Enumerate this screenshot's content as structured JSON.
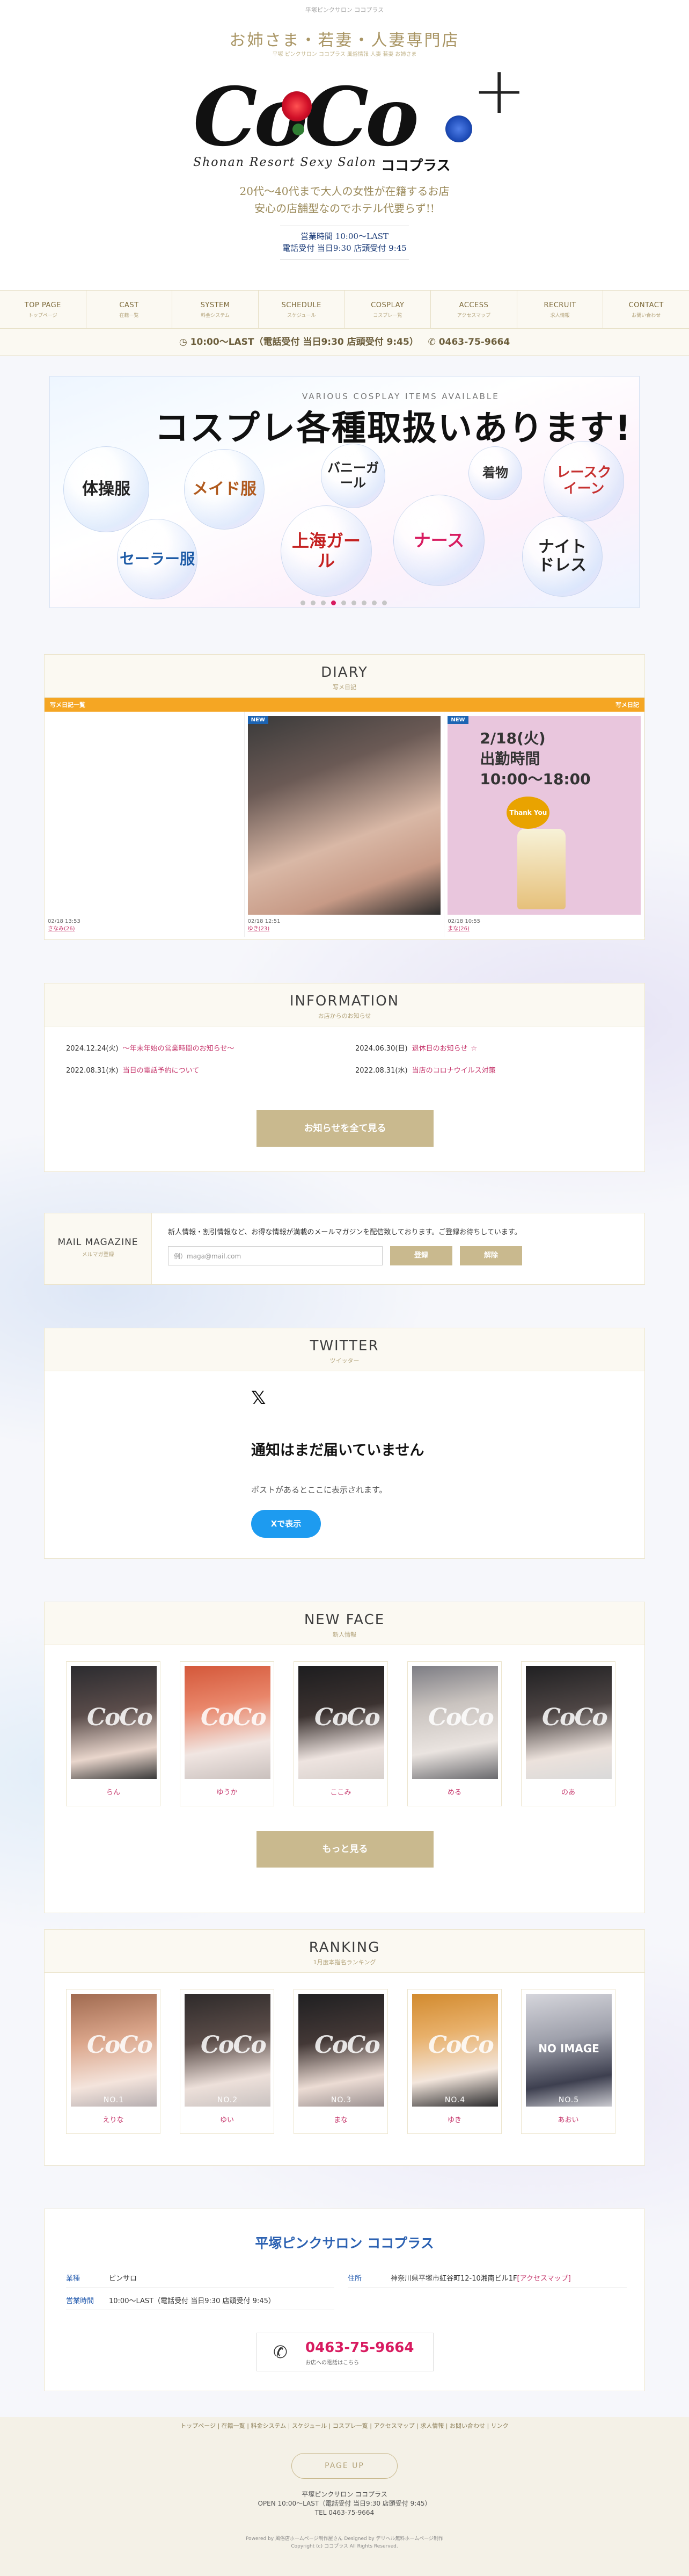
{
  "header": {
    "top_tagline": "平塚ピンクサロン ココプラス",
    "catch_main": "お姉さま・若妻・人妻専門店",
    "catch_sub": "平塚 ピンクサロン ココプラス 風俗情報 人妻 若妻 お姉さま",
    "logo_text": "CoCo",
    "logo_plus": "+",
    "logo_sub": "Shonan Resort Sexy Salon",
    "logo_kana": "ココプラス",
    "catch_line1": "20代～40代まで大人の女性が在籍するお店",
    "catch_line2": "安心の店舗型なのでホテル代要らず!!",
    "hours1": "営業時間 10:00～LAST",
    "hours2": "電話受付 当日9:30 店頭受付 9:45"
  },
  "nav": [
    {
      "en": "TOP PAGE",
      "jp": "トップページ"
    },
    {
      "en": "CAST",
      "jp": "在籍一覧"
    },
    {
      "en": "SYSTEM",
      "jp": "料金システム"
    },
    {
      "en": "SCHEDULE",
      "jp": "スケジュール"
    },
    {
      "en": "COSPLAY",
      "jp": "コスプレ一覧"
    },
    {
      "en": "ACCESS",
      "jp": "アクセスマップ"
    },
    {
      "en": "RECRUIT",
      "jp": "求人情報"
    },
    {
      "en": "CONTACT",
      "jp": "お問い合わせ"
    }
  ],
  "infobar": {
    "hours": "10:00～LAST（電話受付 当日9:30 店頭受付 9:45）",
    "tel": "0463-75-9664"
  },
  "banner": {
    "sub": "VARIOUS COSPLAY ITEMS AVAILABLE",
    "title": "コスプレ各種取扱いあります!",
    "items": [
      "体操服",
      "メイド服",
      "バニーガール",
      "着物",
      "レースクイーン",
      "セーラー服",
      "上海ガール",
      "ナース",
      "ナイトドレス"
    ],
    "slide_count": 9,
    "active_slide": 3
  },
  "diary": {
    "title": "DIARY",
    "sub": "写メ日記",
    "bar_left": "写メ日記一覧",
    "bar_right": "写メ日記",
    "new_tag": "NEW",
    "posts": [
      {
        "date": "02/18  13:53",
        "name": "さなみ(26)"
      },
      {
        "date": "02/18  12:51",
        "name": "ゆき(23)"
      },
      {
        "date": "02/18  10:55",
        "name": "まな(26)",
        "text1": "2/18(火)",
        "text2": "出勤時間",
        "text3": "10:00～18:00",
        "sticker": "Thank You"
      }
    ]
  },
  "information": {
    "title": "INFORMATION",
    "sub": "お店からのお知らせ",
    "items": [
      {
        "date": "2024.12.24(火)",
        "title": "年末年始の営業時間のお知らせ"
      },
      {
        "date": "2024.06.30(日)",
        "title": "退休日のお知らせ"
      },
      {
        "date": "2022.08.31(水)",
        "title": "当日の電話予約について"
      },
      {
        "date": "2022.08.31(水)",
        "title": "当店のコロナウイルス対策"
      }
    ],
    "button": "お知らせを全て見る"
  },
  "mail": {
    "title": "MAIL MAGAZINE",
    "sub": "メルマガ登録",
    "desc": "新人情報・割引情報など、お得な情報が満載のメールマガジンを配信致しております。ご登録お待ちしています。",
    "placeholder": "例）maga@mail.com",
    "register": "登録",
    "cancel": "解除"
  },
  "twitter": {
    "title": "TWITTER",
    "sub": "ツイッター",
    "icon": "x-logo-icon",
    "heading": "通知はまだ届いていません",
    "body": "ポストがあるとここに表示されます。",
    "button": "Xで表示"
  },
  "newface": {
    "title": "NEW FACE",
    "sub": "新人情報",
    "girls": [
      {
        "name": "らん"
      },
      {
        "name": "ゆうか"
      },
      {
        "name": "ここみ"
      },
      {
        "name": "める"
      },
      {
        "name": "のあ"
      }
    ],
    "button": "もっと見る"
  },
  "ranking": {
    "title": "RANKING",
    "sub": "1月度本指名ランキング",
    "girls": [
      {
        "no": "NO.1",
        "name": "えりな"
      },
      {
        "no": "NO.2",
        "name": "ゆい"
      },
      {
        "no": "NO.3",
        "name": "まな"
      },
      {
        "no": "NO.4",
        "name": "ゆき"
      },
      {
        "no": "NO.5",
        "name": "あおい",
        "noimage": "NO IMAGE"
      }
    ]
  },
  "shop": {
    "title": "平塚ピンクサロン ココプラス",
    "type_label": "業種",
    "type": "ピンサロ",
    "hours_label": "営業時間",
    "hours": "10:00～LAST（電話受付 当日9:30 店頭受付 9:45）",
    "addr_label": "住所",
    "addr": "神奈川県平塚市紅谷町12-10湘南ビル1F",
    "map_link": "[アクセスマップ]",
    "tel": "0463-75-9664",
    "tel_sub": "お店への電話はこちら"
  },
  "footer": {
    "nav": "トップページ | 在籍一覧 | 料金システム | スケジュール | コスプレ一覧 | アクセスマップ | 求人情報 | お問い合わせ | リンク",
    "pageup": "PAGE UP",
    "name": "平塚ピンクサロン ココプラス",
    "open": "OPEN 10:00～LAST（電話受付 当日9:30 店頭受付 9:45）",
    "tel": "TEL 0463-75-9664",
    "powered": "Powered by 風俗店ホームページ制作屋さん  Designed by デリヘル無料ホームページ制作",
    "copy": "Copyright (c) ココプラス All Rights Reserved."
  },
  "colors": {
    "gold": "#c9b98e",
    "pink": "#c6376c",
    "blue": "#2d62b2",
    "orange": "#f5a623"
  }
}
